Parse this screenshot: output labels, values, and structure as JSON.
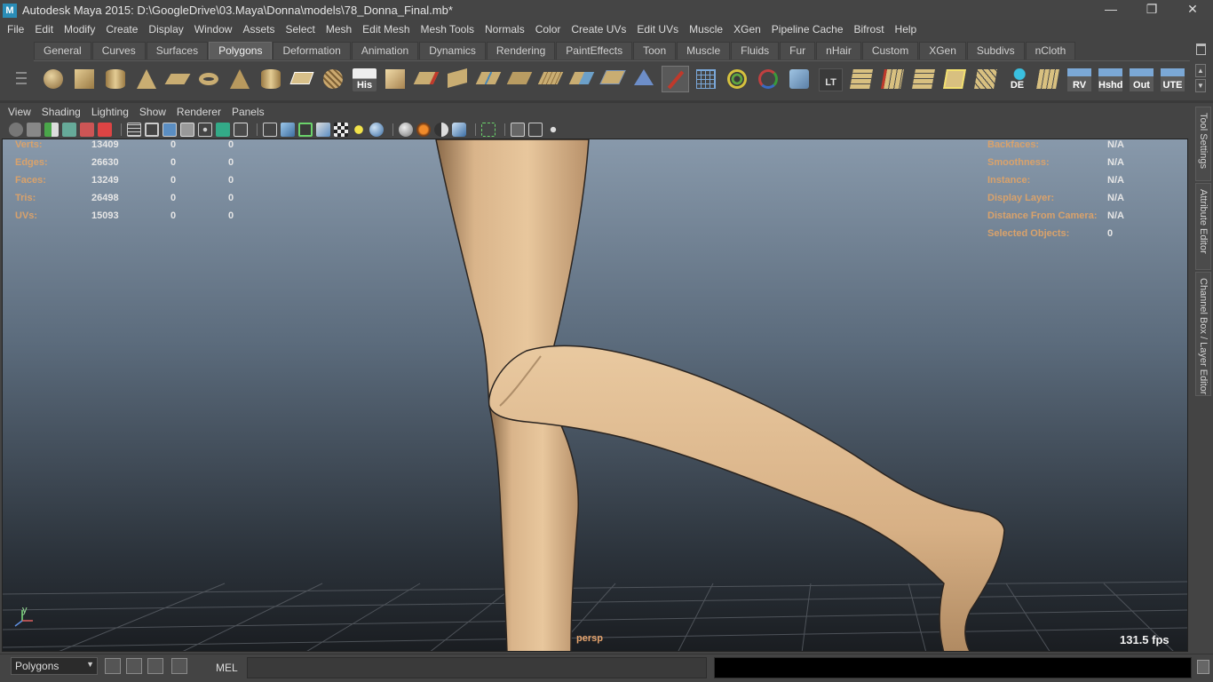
{
  "window": {
    "title": "Autodesk Maya 2015: D:\\GoogleDrive\\03.Maya\\Donna\\models\\78_Donna_Final.mb*",
    "app_icon_letter": "M",
    "minimize": "—",
    "restore": "❐",
    "close": "✕"
  },
  "menubar": [
    "File",
    "Edit",
    "Modify",
    "Create",
    "Display",
    "Window",
    "Assets",
    "Select",
    "Mesh",
    "Edit Mesh",
    "Mesh Tools",
    "Normals",
    "Color",
    "Create UVs",
    "Edit UVs",
    "Muscle",
    "XGen",
    "Pipeline Cache",
    "Bifrost",
    "Help"
  ],
  "shelf_tabs": {
    "items": [
      "General",
      "Curves",
      "Surfaces",
      "Polygons",
      "Deformation",
      "Animation",
      "Dynamics",
      "Rendering",
      "PaintEffects",
      "Toon",
      "Muscle",
      "Fluids",
      "Fur",
      "nHair",
      "Custom",
      "XGen",
      "Subdivs",
      "nCloth"
    ],
    "active": "Polygons"
  },
  "shelf_text_icons": {
    "his": "His",
    "lt": "LT",
    "de": "DE",
    "rv": "RV",
    "hshd": "Hshd",
    "out": "Out",
    "ute": "UTE"
  },
  "panel_menu": [
    "View",
    "Shading",
    "Lighting",
    "Show",
    "Renderer",
    "Panels"
  ],
  "hud_left": [
    {
      "label": "Verts:",
      "v1": "13409",
      "v2": "0",
      "v3": "0"
    },
    {
      "label": "Edges:",
      "v1": "26630",
      "v2": "0",
      "v3": "0"
    },
    {
      "label": "Faces:",
      "v1": "13249",
      "v2": "0",
      "v3": "0"
    },
    {
      "label": "Tris:",
      "v1": "26498",
      "v2": "0",
      "v3": "0"
    },
    {
      "label": "UVs:",
      "v1": "15093",
      "v2": "0",
      "v3": "0"
    }
  ],
  "hud_right": [
    {
      "label": "Backfaces:",
      "value": "N/A"
    },
    {
      "label": "Smoothness:",
      "value": "N/A"
    },
    {
      "label": "Instance:",
      "value": "N/A"
    },
    {
      "label": "Display Layer:",
      "value": "N/A"
    },
    {
      "label": "Distance From Camera:",
      "value": "N/A"
    },
    {
      "label": "Selected Objects:",
      "value": "0"
    }
  ],
  "viewport": {
    "camera": "persp",
    "fps": "131.5 fps",
    "axis_y": "y"
  },
  "side_tabs": [
    "Tool Settings",
    "Attribute Editor",
    "Channel Box / Layer Editor"
  ],
  "bottom": {
    "mode": "Polygons",
    "command_language": "MEL"
  }
}
